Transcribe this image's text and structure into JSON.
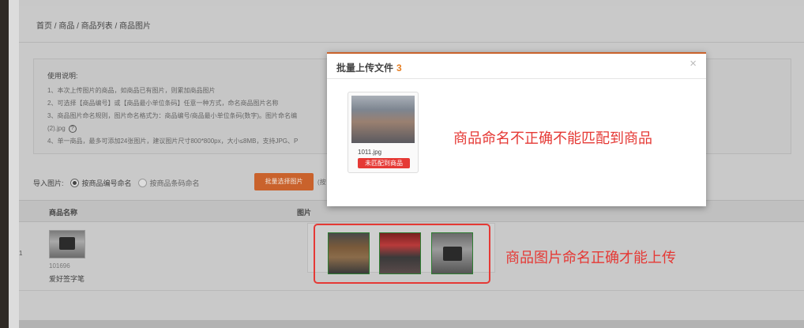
{
  "breadcrumb": "首页 / 商品 / 商品列表 / 商品图片",
  "instructions": {
    "title": "使用说明:",
    "lines": [
      "1、本次上传图片的商品，如商品已有图片，则累加商品图片",
      "2、可选择【商品编号】或【商品最小单位条码】任意一种方式，命名商品图片名称",
      "3、商品图片命名规则，图片命名格式为：商品编号/商品最小单位条码(数字)。图片命名编",
      "(2).jpg",
      "4、单一商品，最多可添加24张图片，建议图片尺寸800*800px，大小≤8MB，支持JPG、P"
    ],
    "help_icon": "question-circle-icon"
  },
  "import": {
    "label": "导入图片:",
    "option_code": "按商品编号命名",
    "option_barcode": "按商品条码命名",
    "selected": "option_code",
    "batch_button": "批量选择图片",
    "tip": "(按"
  },
  "table": {
    "col_name": "商品名称",
    "col_image": "图片",
    "rows": [
      {
        "index": "1",
        "code": "101696",
        "name": "爱好签字笔"
      }
    ]
  },
  "annotations": {
    "bottom": "商品图片命名正确才能上传",
    "top": "商品命名不正确不能匹配到商品"
  },
  "modal": {
    "title": "批量上传文件",
    "count": "3",
    "close": "×",
    "file": {
      "name": "1011.jpg",
      "status": "未匹配到商品"
    }
  },
  "colors": {
    "accent": "#c9622c",
    "error": "#e53935",
    "count": "#e67e22",
    "thumb_border": "#2e7d32"
  }
}
